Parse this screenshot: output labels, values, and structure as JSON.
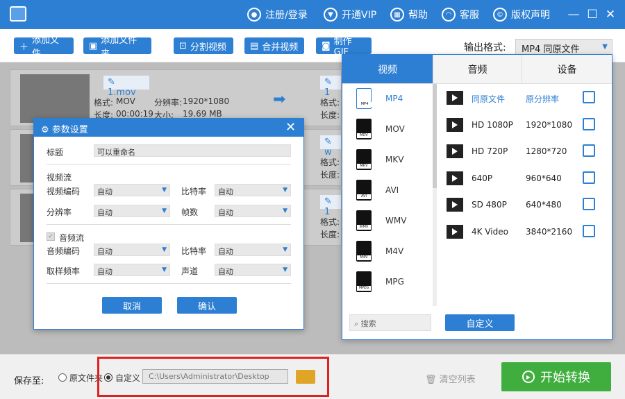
{
  "titlebar": {
    "register_login": "注册/登录",
    "vip": "开通VIP",
    "help": "帮助",
    "service": "客服",
    "copyright": "版权声明"
  },
  "toolbar": {
    "add_file": "添加文件",
    "add_folder": "添加文件夹",
    "split_video": "分割视频",
    "merge_video": "合并视频",
    "make_gif": "制作GIF",
    "output_format_label": "输出格式:",
    "output_format_value": "MP4  同原文件"
  },
  "files": [
    {
      "name": "1.mov",
      "format_label": "格式:",
      "format": "MOV",
      "res_label": "分辨率:",
      "resolution": "1920*1080",
      "dur_label": "长度:",
      "duration": "00:00:19",
      "size_label": "大小:",
      "size": "19.69 MB"
    }
  ],
  "file_fragments": {
    "row2_name": "w",
    "row3_name": "1",
    "fmt": "格式:",
    "len": "长度:",
    "row1_name": "1"
  },
  "dialog": {
    "title": "参数设置",
    "title_label": "标题",
    "title_value": "可以重命名",
    "video_stream": "视频流",
    "video_codec": "视频编码",
    "bitrate": "比特率",
    "resolution": "分辨率",
    "framerate": "帧数",
    "audio_stream": "音频流",
    "audio_codec": "音频编码",
    "audio_bitrate": "比特率",
    "sample_rate": "取样频率",
    "channel": "声道",
    "auto": "自动",
    "cancel": "取消",
    "confirm": "确认"
  },
  "panel": {
    "tabs": [
      "视频",
      "音频",
      "设备"
    ],
    "formats": [
      {
        "label": "MP4",
        "tag": "MP4"
      },
      {
        "label": "MOV",
        "tag": "MOV"
      },
      {
        "label": "MKV",
        "tag": "MKV"
      },
      {
        "label": "AVI",
        "tag": "AVI"
      },
      {
        "label": "WMV",
        "tag": "WMV"
      },
      {
        "label": "M4V",
        "tag": "M4V"
      },
      {
        "label": "MPG",
        "tag": "MPEG"
      }
    ],
    "resolutions": [
      {
        "name": "同原文件",
        "value": "原分辨率"
      },
      {
        "name": "HD 1080P",
        "value": "1920*1080"
      },
      {
        "name": "HD 720P",
        "value": "1280*720"
      },
      {
        "name": "640P",
        "value": "960*640"
      },
      {
        "name": "SD 480P",
        "value": "640*480"
      },
      {
        "name": "4K Video",
        "value": "3840*2160"
      }
    ],
    "search_placeholder": "搜索",
    "custom": "自定义"
  },
  "bottom": {
    "save_to": "保存至:",
    "original_folder": "原文件夹",
    "custom": "自定义",
    "path": "C:\\Users\\Administrator\\Desktop",
    "clear_list": "清空列表",
    "start": "开始转换"
  },
  "colors": {
    "accent": "#2d7fd3",
    "start": "#3fae3f",
    "highlight": "#e02020"
  }
}
